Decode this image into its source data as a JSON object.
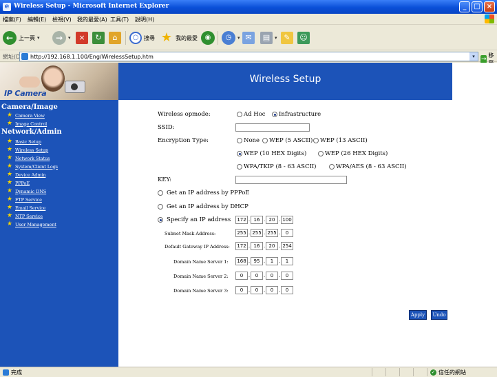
{
  "window": {
    "title": "Wireless Setup - Microsoft Internet Explorer",
    "minimize": "_",
    "maximize": "□",
    "close": "×"
  },
  "menubar": [
    "檔案(F)",
    "編輯(E)",
    "檢視(V)",
    "我的最愛(A)",
    "工具(T)",
    "說明(H)"
  ],
  "toolbar": {
    "back_label": "上一頁",
    "search_label": "搜尋",
    "favorites_label": "我的最愛"
  },
  "address": {
    "label": "網址(D)",
    "url": "http://192.168.1.100/Eng/WirelessSetup.htm",
    "go_label": "移至"
  },
  "header": {
    "brand": "IP Camera",
    "title": "Wireless Setup"
  },
  "sidebar": {
    "section1": "Camera/Image",
    "section1_items": [
      "Camera View",
      "Image Control"
    ],
    "section2": "Network/Admin",
    "section2_items": [
      "Basic Setup",
      "Wireless Setup",
      "Network Status",
      "System/Client Logs",
      "Device Admin",
      "PPPoE",
      "Dynamic DNS",
      "FTP Service",
      "Email Service",
      "NTP Service",
      "User Management"
    ]
  },
  "form": {
    "opmode_label": "Wireless opmode:",
    "opmode_options": [
      "Ad Hoc",
      "Infrastructure"
    ],
    "opmode_selected": "Infrastructure",
    "ssid_label": "SSID:",
    "ssid_value": "",
    "enc_label": "Encryption Type:",
    "enc_options": [
      "None",
      "WEP (5 ASCII)",
      "WEP (13 ASCII)",
      "WEP (10 HEX Digits)",
      "WEP (26 HEX Digits)",
      "WPA/TKIP (8 - 63 ASCII)",
      "WPA/AES (8 - 63 ASCII)"
    ],
    "enc_selected": "WEP (10 HEX Digits)",
    "key_label": "KEY:",
    "key_value": "",
    "ip_modes": [
      "Get an IP address by PPPoE",
      "Get an IP address by DHCP",
      "Specify an IP address"
    ],
    "ip_mode_selected": "Specify an IP address",
    "ip_address": [
      "172",
      "16",
      "20",
      "100"
    ],
    "subnet_label": "Subnet Mask Address:",
    "subnet": [
      "255",
      "255",
      "255",
      "0"
    ],
    "gateway_label": "Default Gateway IP Address:",
    "gateway": [
      "172",
      "16",
      "20",
      "254"
    ],
    "dns1_label": "Domain Name Server 1:",
    "dns1": [
      "168",
      "95",
      "1",
      "1"
    ],
    "dns2_label": "Domain Name Server 2:",
    "dns2": [
      "0",
      "0",
      "0",
      "0"
    ],
    "dns3_label": "Domain Name Server 3:",
    "dns3": [
      "0",
      "0",
      "0",
      "0"
    ],
    "apply_label": "Apply",
    "undo_label": "Undo"
  },
  "status": {
    "text": "完成",
    "zone": "信任的網站"
  },
  "colors": {
    "sidebar_blue": "#1c53b8",
    "star_yellow": "#f5d400"
  }
}
